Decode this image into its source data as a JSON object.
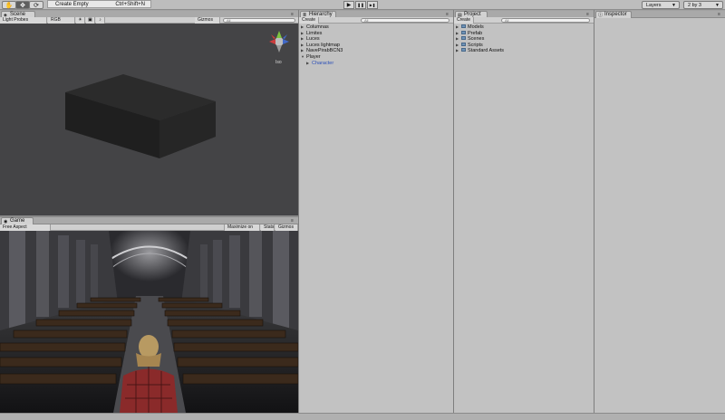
{
  "toolbar": {
    "tools": [
      {
        "name": "hand-tool",
        "glyph": "✋"
      },
      {
        "name": "move-tool",
        "glyph": "✥"
      },
      {
        "name": "rotate-tool",
        "glyph": "⟳"
      }
    ],
    "context_menu": {
      "label": "Create Empty",
      "shortcut": "Ctrl+Shift+N"
    },
    "play": {
      "play": "▶",
      "pause": "❚❚",
      "step": "▶❚"
    },
    "layers_label": "Layers",
    "layout_label": "2 by 3"
  },
  "scene": {
    "tab": "Scene",
    "render_mode": "Light Probes",
    "color_mode": "RGB",
    "gizmos": "Gizmos",
    "search_placeholder": "All",
    "gizmo_label": "Iso"
  },
  "game": {
    "tab": "Game",
    "aspect": "Free Aspect",
    "maximize": "Maximize on Play",
    "stats": "Stats",
    "gizmos": "Gizmos"
  },
  "hierarchy": {
    "tab": "Hierarchy",
    "create": "Create",
    "search_placeholder": "All",
    "items": [
      {
        "label": "Columnas",
        "arrow": "▶"
      },
      {
        "label": "Limites",
        "arrow": "▶"
      },
      {
        "label": "Luces",
        "arrow": "▶"
      },
      {
        "label": "Luces lightmap",
        "arrow": "▶"
      },
      {
        "label": "NavePirabBCN3",
        "arrow": "▶"
      },
      {
        "label": "Player",
        "arrow": "▼"
      }
    ],
    "child": {
      "label": "Character",
      "arrow": "▶"
    }
  },
  "project": {
    "tab": "Project",
    "create": "Create",
    "search_placeholder": "All",
    "folders": [
      {
        "label": "Models",
        "arrow": "▶"
      },
      {
        "label": "Prefab",
        "arrow": "▶"
      },
      {
        "label": "Scenes",
        "arrow": "▶"
      },
      {
        "label": "Scripts",
        "arrow": "▶"
      },
      {
        "label": "Standard Assets",
        "arrow": "▶"
      }
    ]
  },
  "inspector": {
    "tab": "Inspector"
  },
  "colors": {
    "accent": "#2a4fb8",
    "panel_bg": "#c2c2c2",
    "scene_bg": "#444446"
  }
}
